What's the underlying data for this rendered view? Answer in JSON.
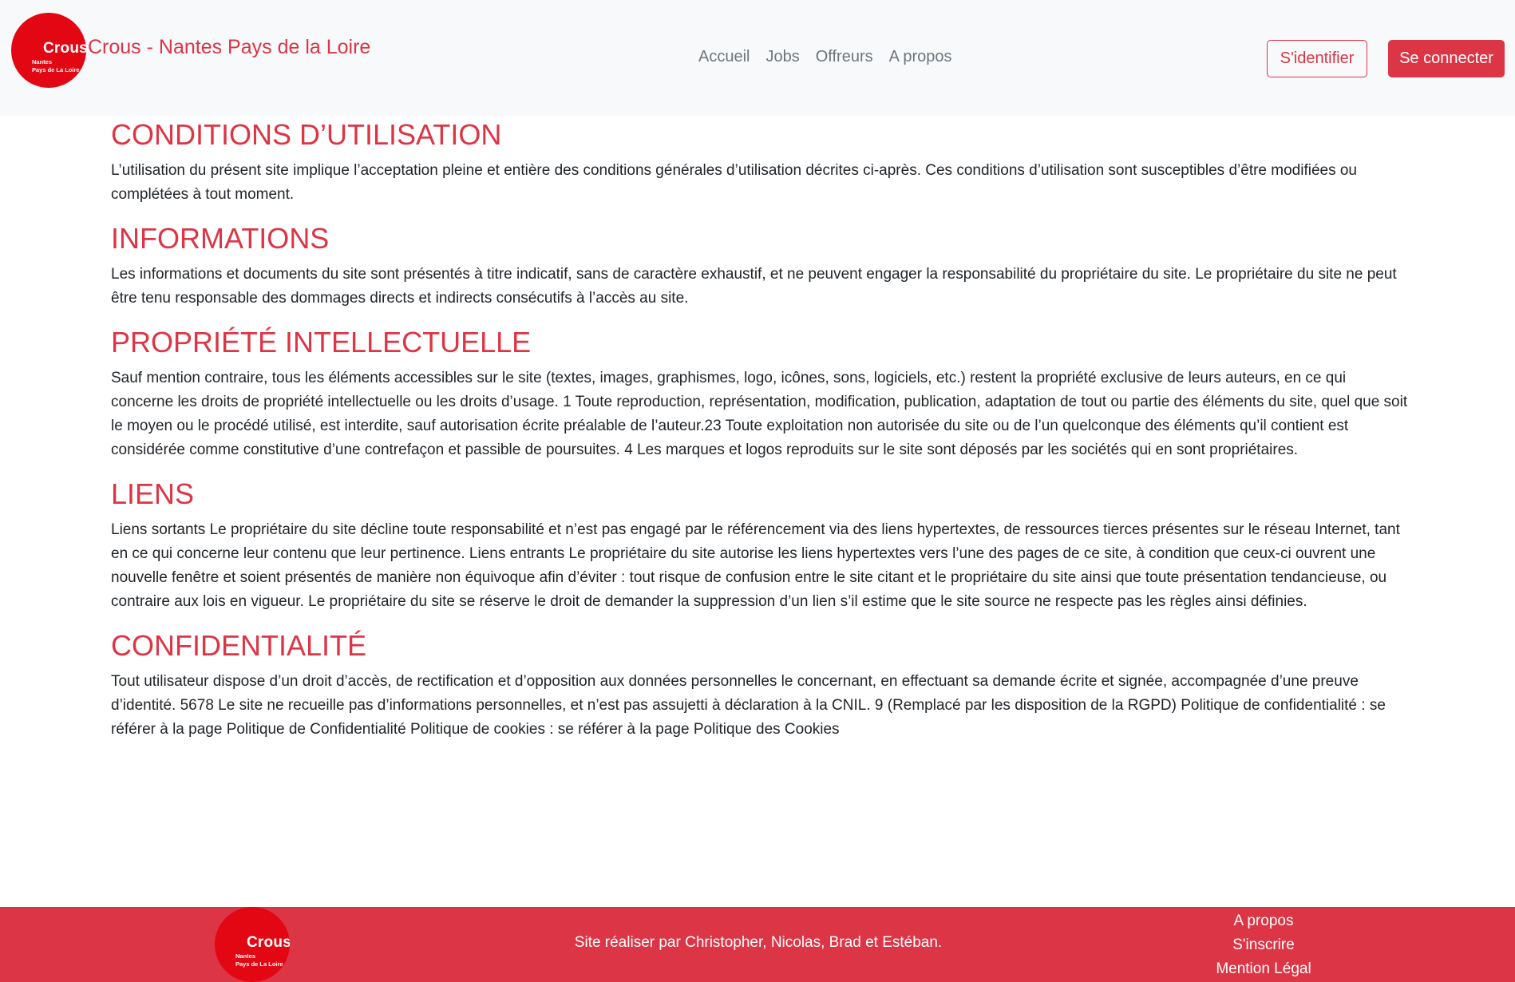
{
  "header": {
    "logo": {
      "word": "Crous",
      "sub_line1": "Nantes",
      "sub_line2": "Pays de La Loire"
    },
    "brand_title": "Crous - Nantes Pays de la Loire",
    "nav": [
      "Accueil",
      "Jobs",
      "Offreurs",
      "A propos"
    ],
    "login_button": "S'identifier",
    "connect_button": "Se connecter"
  },
  "sections": [
    {
      "title": "CONDITIONS D’UTILISATION",
      "text": "L’utilisation du présent site implique l’acceptation pleine et entière des conditions générales d’utilisation décrites ci-après. Ces conditions d’utilisation sont susceptibles d’être modifiées ou complétées à tout moment."
    },
    {
      "title": "INFORMATIONS",
      "text": "Les informations et documents du site sont présentés à titre indicatif, sans de caractère exhaustif, et ne peuvent engager la responsabilité du propriétaire du site. Le propriétaire du site ne peut être tenu responsable des dommages directs et indirects consécutifs à l’accès au site."
    },
    {
      "title": "PROPRIÉTÉ INTELLECTUELLE",
      "text": "Sauf mention contraire, tous les éléments accessibles sur le site (textes, images, graphismes, logo, icônes, sons, logiciels, etc.) restent la propriété exclusive de leurs auteurs, en ce qui concerne les droits de propriété intellectuelle ou les droits d’usage. 1 Toute reproduction, représentation, modification, publication, adaptation de tout ou partie des éléments du site, quel que soit le moyen ou le procédé utilisé, est interdite, sauf autorisation écrite préalable de l’auteur.23 Toute exploitation non autorisée du site ou de l’un quelconque des éléments qu’il contient est considérée comme constitutive d’une contrefaçon et passible de poursuites. 4 Les marques et logos reproduits sur le site sont déposés par les sociétés qui en sont propriétaires."
    },
    {
      "title": "LIENS",
      "text": "Liens sortants Le propriétaire du site décline toute responsabilité et n’est pas engagé par le référencement via des liens hypertextes, de ressources tierces présentes sur le réseau Internet, tant en ce qui concerne leur contenu que leur pertinence. Liens entrants Le propriétaire du site autorise les liens hypertextes vers l’une des pages de ce site, à condition que ceux-ci ouvrent une nouvelle fenêtre et soient présentés de manière non équivoque afin d’éviter : tout risque de confusion entre le site citant et le propriétaire du site ainsi que toute présentation tendancieuse, ou contraire aux lois en vigueur. Le propriétaire du site se réserve le droit de demander la suppression d’un lien s’il estime que le site source ne respecte pas les règles ainsi définies."
    },
    {
      "title": "CONFIDENTIALITÉ",
      "text": "Tout utilisateur dispose d’un droit d’accès, de rectification et d’opposition aux données personnelles le concernant, en effectuant sa demande écrite et signée, accompagnée d’une preuve d’identité. 5678 Le site ne recueille pas d’informations personnelles, et n’est pas assujetti à déclaration à la CNIL. 9 (Remplacé par les disposition de la RGPD) Politique de confidentialité : se référer à la page Politique de Confidentialité Politique de cookies : se référer à la page Politique des Cookies"
    }
  ],
  "footer": {
    "credit": "Site réaliser par Christopher, Nicolas, Brad et Estéban.",
    "links": [
      "A propos",
      "S'inscrire",
      "Mention Légal"
    ]
  },
  "colors": {
    "accent": "#dc3545",
    "logo_red": "#e30613",
    "header_bg": "#f8f9fa"
  }
}
